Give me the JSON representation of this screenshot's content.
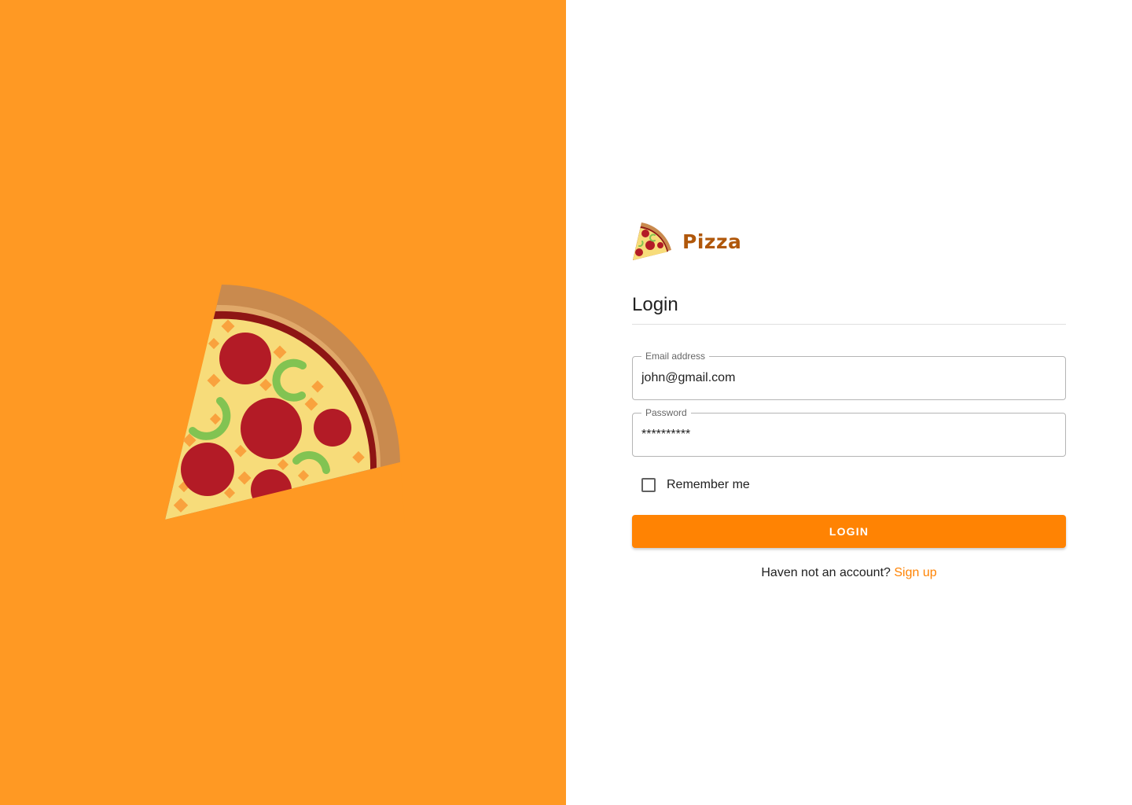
{
  "colors": {
    "hero_background": "#FF9923",
    "accent": "#FF8303",
    "brand_text": "#B0570A"
  },
  "hero": {
    "icon": "pizza-slice-icon"
  },
  "brand": {
    "name": "Pizza",
    "icon": "pizza-slice-icon"
  },
  "form": {
    "title": "Login",
    "email": {
      "label": "Email address",
      "value": "john@gmail.com"
    },
    "password": {
      "label": "Password",
      "value": "**********"
    },
    "remember": {
      "label": "Remember me",
      "checked": false
    },
    "submit_label": "LOGIN",
    "signup_prompt": "Haven not an account?",
    "signup_link": "Sign up"
  }
}
